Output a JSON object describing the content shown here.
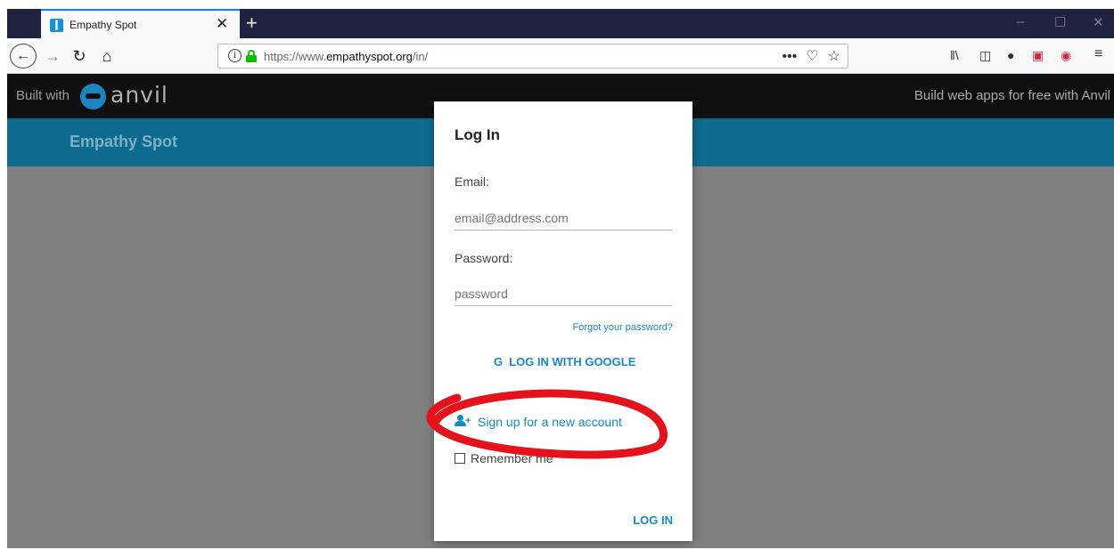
{
  "browser": {
    "tab": {
      "title": "Empathy Spot"
    },
    "url": {
      "prefix": "https://www.",
      "domain": "empathyspot.org",
      "path": "/in/"
    },
    "toolbar_icons": [
      "library-icon",
      "sidebar-icon",
      "account-icon",
      "pocket-icon",
      "extension-icon",
      "menu-icon"
    ]
  },
  "anvil_bar": {
    "built_with": "Built with",
    "logo_text": "anvil",
    "promo": "Build web apps for free with Anvil"
  },
  "app": {
    "title": "Empathy Spot"
  },
  "login": {
    "title": "Log In",
    "email_label": "Email:",
    "email_placeholder": "email@address.com",
    "password_label": "Password:",
    "password_placeholder": "password",
    "forgot": "Forgot your password?",
    "google_label": "LOG IN WITH GOOGLE",
    "signup": "Sign up for a new account",
    "remember": "Remember me",
    "login_button": "LOG IN"
  },
  "colors": {
    "accent": "#1a88c2",
    "header": "#0d6b8f",
    "annotation": "#e3121b"
  }
}
